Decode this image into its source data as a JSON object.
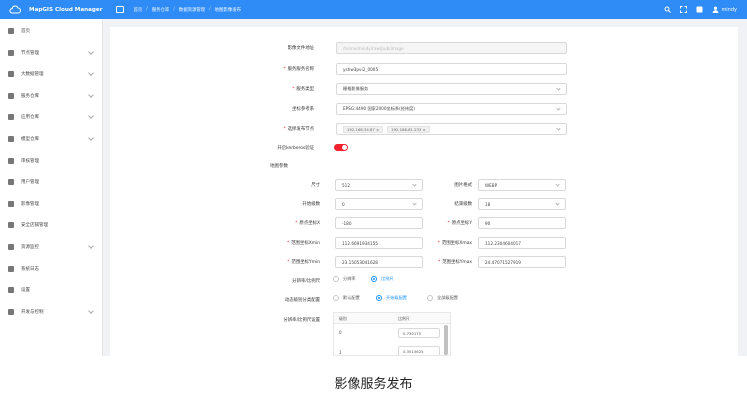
{
  "app": {
    "title": "MapGIS Cloud Manager"
  },
  "breadcrumbs": [
    "首页",
    "服务仓库",
    "数据资源管理",
    "地图影像发布"
  ],
  "topbar": {
    "user": "mindy"
  },
  "sidebar": {
    "items": [
      {
        "label": "首页",
        "expandable": false
      },
      {
        "label": "节点管理",
        "expandable": true
      },
      {
        "label": "大数据管理",
        "expandable": true
      },
      {
        "label": "服务仓库",
        "expandable": true
      },
      {
        "label": "应用仓库",
        "expandable": true
      },
      {
        "label": "模型仓库",
        "expandable": true
      },
      {
        "label": "审核管理",
        "expandable": false
      },
      {
        "label": "用户管理",
        "expandable": false
      },
      {
        "label": "影像管理",
        "expandable": false
      },
      {
        "label": "安全店铺管理",
        "expandable": false
      },
      {
        "label": "资源监控",
        "expandable": true
      },
      {
        "label": "系统日志",
        "expandable": false
      },
      {
        "label": "设置",
        "expandable": false
      },
      {
        "label": "开发与控制",
        "expandable": true
      }
    ]
  },
  "form": {
    "image_path_label": "影像文件地址",
    "image_path_value": "/home/mindy/raw/pub/image",
    "service_name_label": "服务服务名称",
    "service_name_value": "yshw3pvi2_0005",
    "service_type_label": "服务类型",
    "service_type_value": "栅格影像服务",
    "coord_system_label": "坐标参考系",
    "coord_system_value": "EPSG:4490 国家2000坐标系(经纬度)",
    "nodes_label": "选择发布节点",
    "nodes_values": [
      "192.168.34.87",
      "192.168.81.233"
    ],
    "kerberos_label": "开启kerberos验证",
    "kerberos_on": true
  },
  "tile_params": {
    "section_title": "地图参数",
    "size_label": "尺寸",
    "size_value": "512",
    "format_label": "图片格式",
    "format_value": "WEBP",
    "start_level_label": "开始级数",
    "start_level_value": "0",
    "end_level_label": "结束级数",
    "end_level_value": "18",
    "origin_x_label": "原点坐标X",
    "origin_x_value": "-180",
    "origin_y_label": "原点坐标Y",
    "origin_y_value": "90",
    "xmin_label": "范围坐标Xmin",
    "xmin_value": "112.6691934155",
    "xmax_label": "范围坐标Xmax",
    "xmax_value": "112.2304604017",
    "ymin_label": "范围坐标Ymin",
    "ymin_value": "23.15053041628",
    "ymax_label": "范围坐标Ymax",
    "ymax_value": "24.47071527919"
  },
  "resolution": {
    "label": "分辨率/比例尺",
    "options": [
      "分辨率",
      "比例尺"
    ],
    "selected": "比例尺"
  },
  "dynamic": {
    "label": "动态级别分类配置",
    "options": [
      "默认配置",
      "开始级配置",
      "全部级配置"
    ],
    "selected": "开始级配置"
  },
  "level_table": {
    "label": "分辨率/比例尺设置",
    "headers": [
      "级别",
      "比例尺"
    ],
    "rows": [
      {
        "level": "0",
        "value": "0.730175"
      },
      {
        "level": "1",
        "value": "0.3515625"
      }
    ]
  },
  "caption": "影像服务发布"
}
